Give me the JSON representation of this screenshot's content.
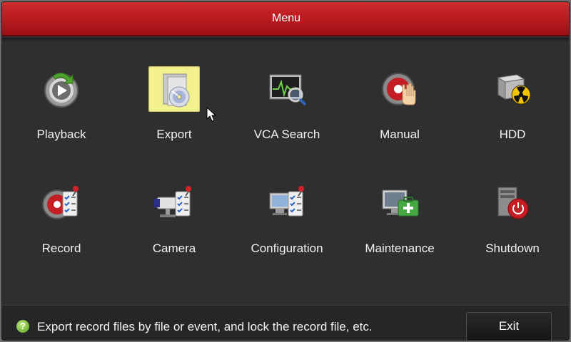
{
  "window": {
    "title": "Menu"
  },
  "tiles": [
    {
      "label": "Playback",
      "icon": "playback-icon",
      "selected": false
    },
    {
      "label": "Export",
      "icon": "export-icon",
      "selected": true
    },
    {
      "label": "VCA Search",
      "icon": "vca-search-icon",
      "selected": false
    },
    {
      "label": "Manual",
      "icon": "manual-record-icon",
      "selected": false
    },
    {
      "label": "HDD",
      "icon": "hdd-icon",
      "selected": false
    },
    {
      "label": "Record",
      "icon": "record-icon",
      "selected": false
    },
    {
      "label": "Camera",
      "icon": "camera-icon",
      "selected": false
    },
    {
      "label": "Configuration",
      "icon": "configuration-icon",
      "selected": false
    },
    {
      "label": "Maintenance",
      "icon": "maintenance-icon",
      "selected": false
    },
    {
      "label": "Shutdown",
      "icon": "shutdown-icon",
      "selected": false
    }
  ],
  "status": {
    "help_text": "Export record files by file or event, and lock the record file, etc."
  },
  "buttons": {
    "exit_label": "Exit"
  },
  "colors": {
    "title_bar": "#b71a1f",
    "background": "#2f2f2f",
    "selection": "#f3f08e"
  }
}
